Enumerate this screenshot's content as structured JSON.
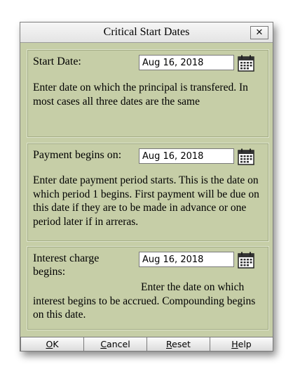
{
  "window": {
    "title": "Critical Start Dates",
    "close_label": "✕"
  },
  "sections": [
    {
      "label": "Start Date:",
      "date_value": "Aug 16, 2018",
      "calendar_icon": "calendar-icon",
      "description": "Enter date on which the principal is transfered. In most cases all three dates are the same"
    },
    {
      "label": "Payment begins on:",
      "date_value": "Aug 16, 2018",
      "calendar_icon": "calendar-icon",
      "description": "Enter date payment period starts. This is the date on which period 1 begins. First payment will be due on this date if they are to be made in advance or one period later if in arreras."
    },
    {
      "label": "Interest charge begins:",
      "date_value": "Aug 16, 2018",
      "calendar_icon": "calendar-icon",
      "description": "Enter the date on which interest begins to be accrued. Compounding begins on this date."
    }
  ],
  "buttons": {
    "ok": {
      "mnemonic": "O",
      "rest": "K"
    },
    "cancel": {
      "mnemonic": "C",
      "rest": "ancel"
    },
    "reset": {
      "mnemonic": "R",
      "rest": "eset"
    },
    "help": {
      "mnemonic": "H",
      "rest": "elp"
    }
  },
  "colors": {
    "dialog_background": "#c6cea7",
    "titlebar_background": "#ececec"
  }
}
